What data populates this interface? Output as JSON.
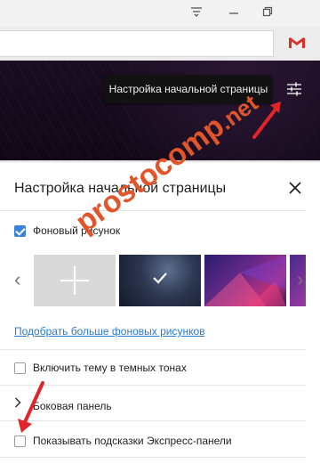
{
  "window": {
    "buttons": [
      "menu-icon",
      "minimize-icon",
      "restore-icon"
    ]
  },
  "toolbar": {
    "gmail_icon": "gmail-icon"
  },
  "banner": {
    "tooltip": "Настройка начальной страницы",
    "settings_icon": "sliders-icon"
  },
  "panel": {
    "title": "Настройка начальной страницы",
    "close_icon": "close-icon",
    "background_checkbox_label": "Фоновый рисунок",
    "background_checked": true,
    "thumbnails": [
      {
        "name": "add-background",
        "selected": false
      },
      {
        "name": "dark-blue",
        "selected": true
      },
      {
        "name": "purple-geometry",
        "selected": false
      },
      {
        "name": "purple-partial",
        "selected": false
      }
    ],
    "more_link": "Подобрать больше фоновых рисунков",
    "dark_theme_label": "Включить тему в темных тонах",
    "dark_theme_checked": false,
    "sidebar_label": "Боковая панель",
    "hints_label": "Показывать подсказки Экспресс-панели",
    "hints_checked": false
  },
  "watermark": {
    "text": "prosto",
    "text2": "comp",
    "text3": ".net"
  },
  "colors": {
    "accent": "#3a84d8",
    "link": "#2a7ad0",
    "arrow": "#e0242a",
    "watermark": "#e0552a"
  }
}
